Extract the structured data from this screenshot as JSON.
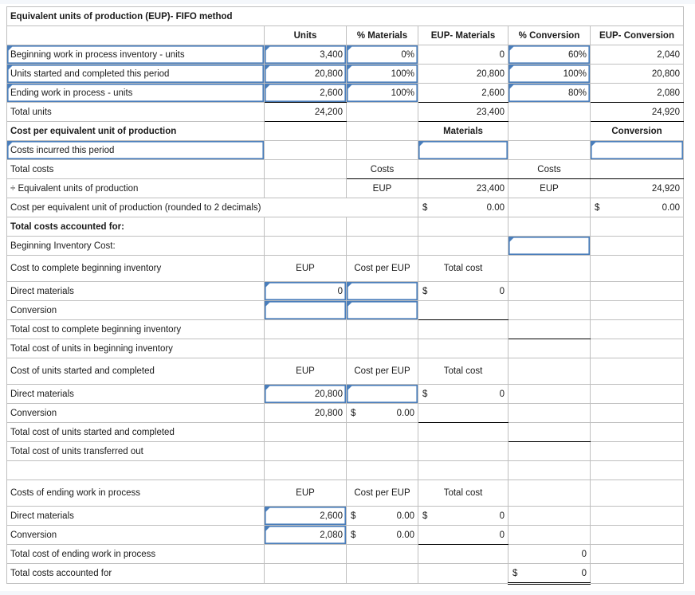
{
  "sheet": {
    "title": "Equivalent units of production (EUP)- FIFO method",
    "currency_symbol": "$",
    "colors": {
      "header_blue": "#7FA8DC",
      "answer_yellow": "#FDF8B6",
      "input_border": "#4A7EBB"
    },
    "columns": {
      "label": "",
      "units": "Units",
      "pct_materials": "% Materials",
      "eup_materials": "EUP- Materials",
      "pct_conversion": "% Conversion",
      "eup_conversion": "EUP- Conversion"
    },
    "eup_rows": [
      {
        "label": "Beginning work in process inventory - units",
        "units": "3,400",
        "pct_materials": "0%",
        "eup_materials": "0",
        "pct_conversion": "60%",
        "eup_conversion": "2,040"
      },
      {
        "label": "Units started and completed this period",
        "units": "20,800",
        "pct_materials": "100%",
        "eup_materials": "20,800",
        "pct_conversion": "100%",
        "eup_conversion": "20,800"
      },
      {
        "label": "Ending work in process - units",
        "units": "2,600",
        "pct_materials": "100%",
        "eup_materials": "2,600",
        "pct_conversion": "80%",
        "eup_conversion": "2,080"
      }
    ],
    "eup_total": {
      "label": "Total units",
      "units": "24,200",
      "pct_materials": "",
      "eup_materials": "23,400",
      "pct_conversion": "",
      "eup_conversion": "24,920"
    },
    "cost_per_unit": {
      "section_title": "Cost per equivalent unit of production",
      "materials_header": "Materials",
      "conversion_header": "Conversion",
      "costs_incurred_label": "Costs incurred this period",
      "costs_incurred_materials": "",
      "costs_incurred_conversion": "",
      "total_costs_label": "Total costs",
      "total_costs_materials_tag": "Costs",
      "total_costs_conversion_tag": "Costs",
      "total_costs_materials_value": "",
      "total_costs_conversion_value": "",
      "divide_label": "÷ Equivalent units of production",
      "divide_materials_tag": "EUP",
      "divide_conversion_tag": "EUP",
      "divide_materials_value": "23,400",
      "divide_conversion_value": "24,920",
      "result_label": "Cost per equivalent unit of production (rounded to 2 decimals)",
      "result_materials": "0.00",
      "result_conversion": "0.00"
    },
    "totals_section": {
      "section_title": "Total costs accounted for:",
      "beginning_inventory_label": "Beginning Inventory Cost:",
      "beginning_inventory_value": "",
      "sub_headers": {
        "eup": "EUP",
        "cost_per_eup": "Cost per EUP",
        "total_cost": "Total cost"
      },
      "complete_beginning": {
        "title": "Cost to complete beginning inventory",
        "rows": [
          {
            "label": "Direct materials",
            "eup": "0",
            "cost_per_eup": "",
            "cost_per_eup_symbol": "",
            "total_cost": "0",
            "total_cost_symbol": "$"
          },
          {
            "label": "Conversion",
            "eup": "",
            "cost_per_eup": "",
            "cost_per_eup_symbol": "",
            "total_cost": "",
            "total_cost_symbol": ""
          }
        ],
        "subtotal_label": "Total cost to complete beginning inventory",
        "subtotal_value": "",
        "grandtotal_label": "Total cost of units in beginning inventory",
        "grandtotal_value": ""
      },
      "started_completed": {
        "title": "Cost of units started and completed",
        "rows": [
          {
            "label": "Direct materials",
            "eup": "20,800",
            "cost_per_eup": "",
            "cost_per_eup_symbol": "",
            "total_cost": "0",
            "total_cost_symbol": "$"
          },
          {
            "label": "Conversion",
            "eup": "20,800",
            "cost_per_eup": "0.00",
            "cost_per_eup_symbol": "$",
            "total_cost": "",
            "total_cost_symbol": ""
          }
        ],
        "subtotal_label": "Total cost of units started and completed",
        "subtotal_value": "",
        "grandtotal_label": "Total cost of units transferred out",
        "grandtotal_value": ""
      },
      "ending_wip": {
        "title": "Costs of ending work in process",
        "rows": [
          {
            "label": "Direct materials",
            "eup": "2,600",
            "cost_per_eup": "0.00",
            "cost_per_eup_symbol": "$",
            "total_cost": "0",
            "total_cost_symbol": "$"
          },
          {
            "label": "Conversion",
            "eup": "2,080",
            "cost_per_eup": "0.00",
            "cost_per_eup_symbol": "$",
            "total_cost": "0",
            "total_cost_symbol": ""
          }
        ],
        "subtotal_label": "Total cost of ending work in process",
        "subtotal_value": "0",
        "grandtotal_label": "Total costs accounted for",
        "grandtotal_value": "0",
        "grandtotal_symbol": "$"
      }
    }
  }
}
